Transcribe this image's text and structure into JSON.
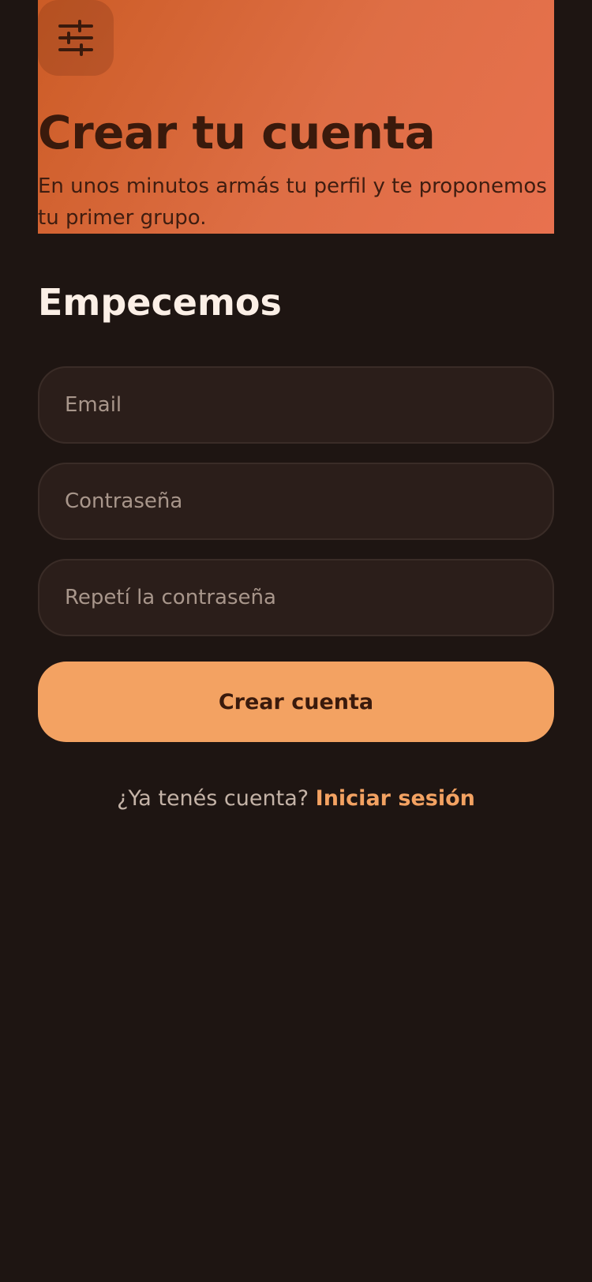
{
  "hero": {
    "filter_icon": "sliders-icon",
    "title": "Crear tu cuenta",
    "subtitle": "En unos minutos armás tu perfil y te proponemos tu primer grupo."
  },
  "form": {
    "heading": "Empecemos",
    "email_placeholder": "Email",
    "password_placeholder": "Contraseña",
    "repeat_password_placeholder": "Repetí la contraseña",
    "submit_label": "Crear cuenta"
  },
  "footer": {
    "question": "¿Ya tenés cuenta?",
    "login_label": "Iniciar sesión"
  },
  "colors": {
    "background": "#1e1512",
    "accent": "#f3a262",
    "hero_gradient_start": "#cc5c26",
    "hero_gradient_end": "#e8714f",
    "field_background": "#2b1e1a"
  }
}
